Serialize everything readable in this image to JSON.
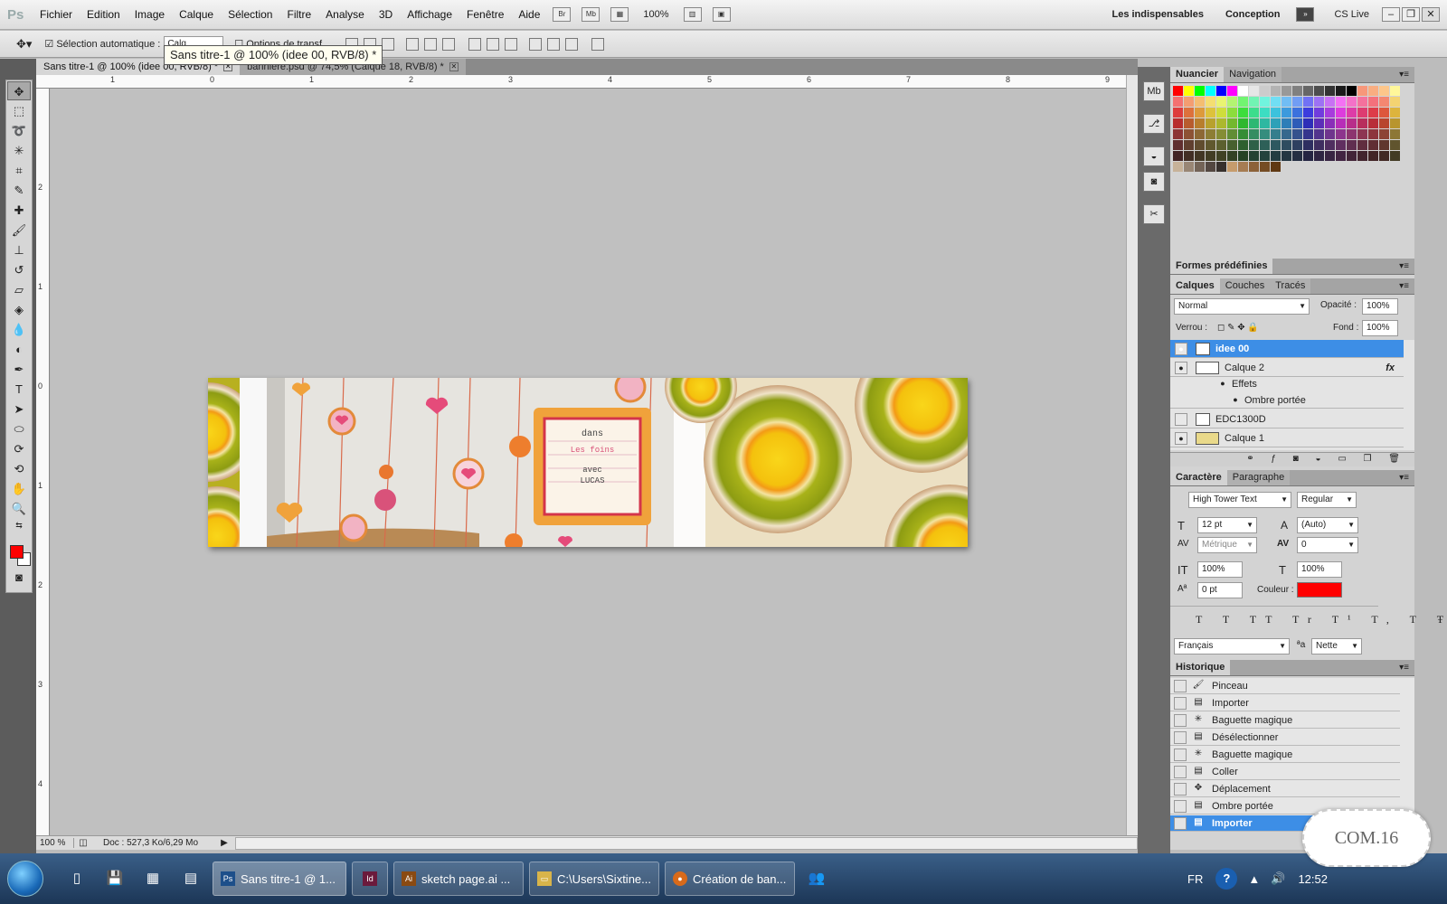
{
  "menubar": {
    "app_logo": "Ps",
    "items": [
      "Fichier",
      "Edition",
      "Image",
      "Calque",
      "Sélection",
      "Filtre",
      "Analyse",
      "3D",
      "Affichage",
      "Fenêtre",
      "Aide"
    ],
    "bridge": "Br",
    "minibridge": "Mb",
    "zoom": "100%",
    "workspaces": [
      "Les indispensables",
      "Conception"
    ],
    "cslive": "CS Live"
  },
  "options": {
    "auto_select": "Sélection automatique :",
    "auto_select_value": "Calq",
    "transform": "Options de transf."
  },
  "tooltip": "Sans titre-1 @ 100% (idee 00, RVB/8) *",
  "doc_tabs": [
    {
      "label": "Sans titre-1 @ 100% (idee 00, RVB/8) *"
    },
    {
      "label": "banniere.psd @ 74,5% (Calque 18, RVB/8) *"
    }
  ],
  "ruler_top": [
    "1",
    "0",
    "1",
    "2",
    "3",
    "4",
    "5",
    "6",
    "7",
    "8",
    "9"
  ],
  "ruler_left": [
    "2",
    "1",
    "0",
    "1",
    "2",
    "3",
    "4"
  ],
  "banner": {
    "line1": "dans",
    "line2": "Les foins",
    "line3": "avec",
    "line4": "LUCAS"
  },
  "status": {
    "zoom": "100 %",
    "doc": "Doc : 527,3 Ko/6,29 Mo"
  },
  "swatches_panel": {
    "tabs": [
      "Nuancier",
      "Navigation"
    ]
  },
  "shapes_panel": {
    "title": "Formes prédéfinies"
  },
  "layers_panel": {
    "tabs": [
      "Calques",
      "Couches",
      "Tracés"
    ],
    "mode": "Normal",
    "opacity_label": "Opacité :",
    "opacity": "100%",
    "lock_label": "Verrou :",
    "fill_label": "Fond :",
    "fill": "100%",
    "fx": "fx",
    "layers": [
      {
        "name": "idee 00"
      },
      {
        "name": "Calque 2"
      },
      {
        "name": "Effets"
      },
      {
        "name": "Ombre portée"
      },
      {
        "name": "EDC1300D"
      },
      {
        "name": "Calque 1"
      }
    ]
  },
  "char_panel": {
    "tabs": [
      "Caractère",
      "Paragraphe"
    ],
    "font": "High Tower Text",
    "style": "Regular",
    "size": "12 pt",
    "leading": "(Auto)",
    "kerning": "Métrique",
    "tracking": "0",
    "vscale": "100%",
    "hscale": "100%",
    "baseline": "0 pt",
    "color_label": "Couleur :",
    "color": "#ff0000",
    "language": "Français",
    "aa_label": "ªa",
    "antialias": "Nette"
  },
  "history_panel": {
    "title": "Historique",
    "items": [
      {
        "label": "Pinceau"
      },
      {
        "label": "Importer"
      },
      {
        "label": "Baguette magique"
      },
      {
        "label": "Désélectionner"
      },
      {
        "label": "Baguette magique"
      },
      {
        "label": "Coller"
      },
      {
        "label": "Déplacement"
      },
      {
        "label": "Ombre portée"
      },
      {
        "label": "Importer"
      }
    ]
  },
  "taskbar": {
    "tasks": [
      {
        "label": "Sans titre-1 @ 1..."
      },
      {
        "label": ""
      },
      {
        "label": "sketch page.ai ..."
      },
      {
        "label": "C:\\Users\\Sixtine..."
      },
      {
        "label": "Création de ban..."
      }
    ],
    "lang": "FR",
    "clock": "12:52"
  },
  "stamp": "COM.16",
  "colors": {
    "accent": "#3d8ee6",
    "foreground": "#ff0000",
    "background": "#ffffff"
  }
}
